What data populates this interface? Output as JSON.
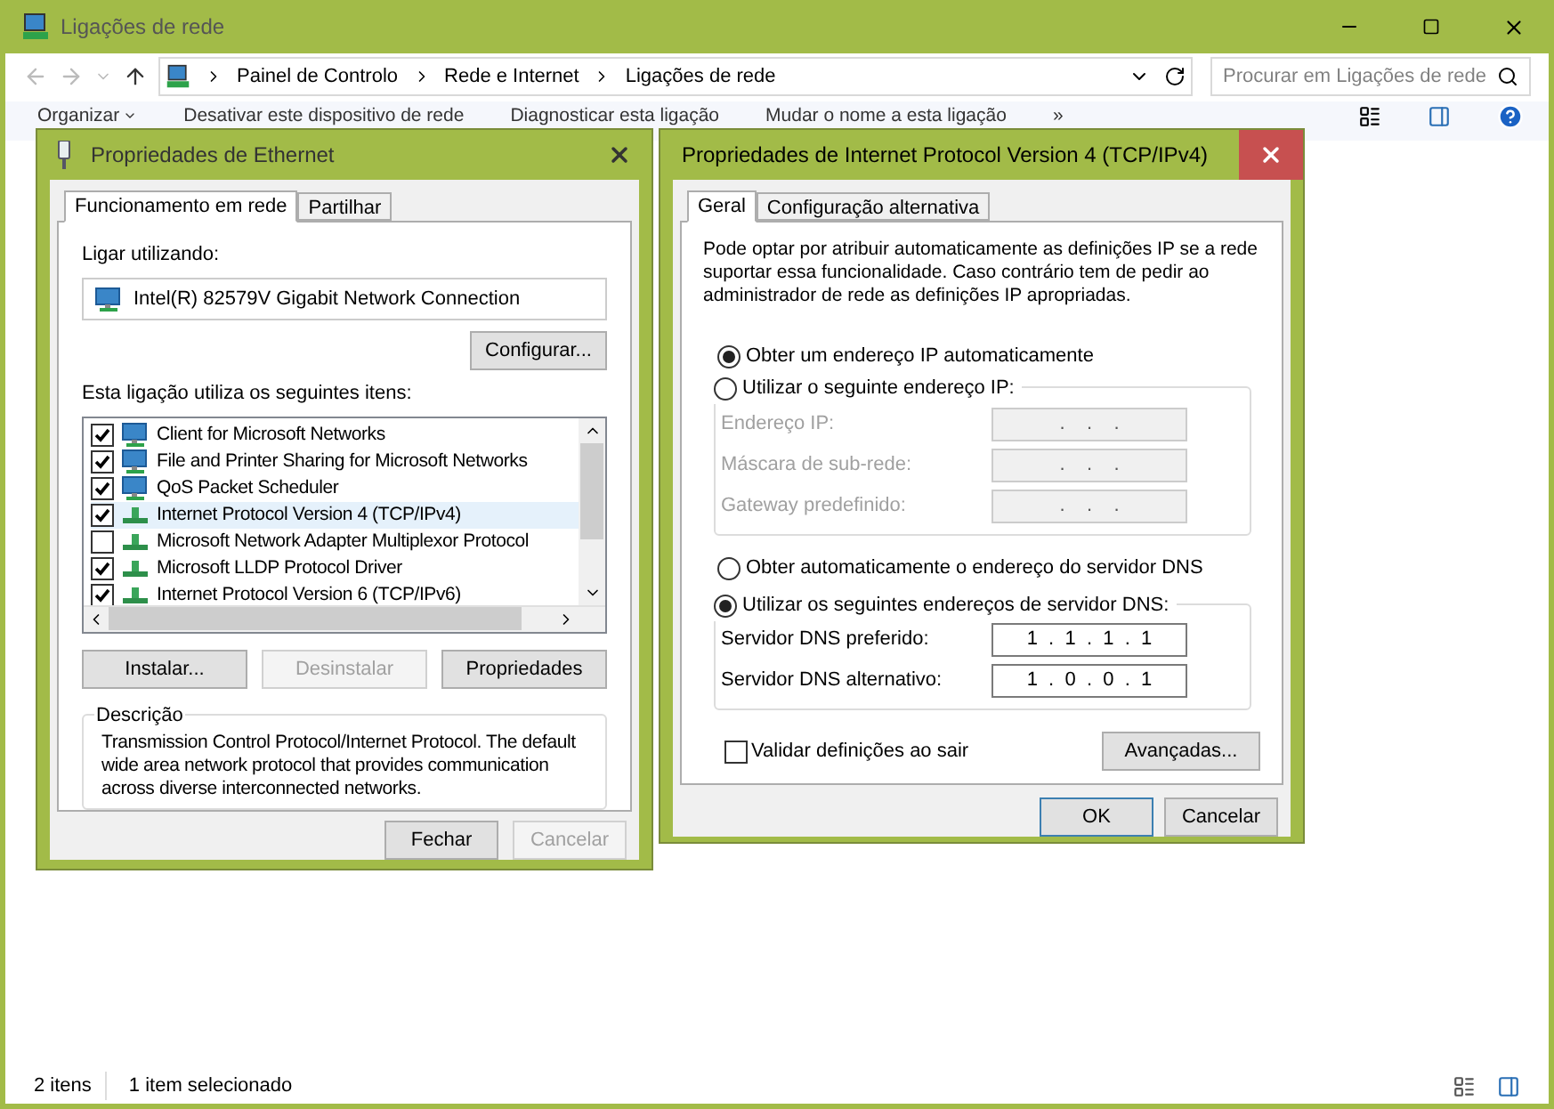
{
  "window": {
    "title": "Ligações de rede"
  },
  "address": {
    "path": [
      "Painel de Controlo",
      "Rede e Internet",
      "Ligações de rede"
    ],
    "search_placeholder": "Procurar em Ligações de rede"
  },
  "toolbar": [
    "Organizar",
    "Desativar este dispositivo de rede",
    "Diagnosticar esta ligação",
    "Mudar o nome a esta ligação",
    "»"
  ],
  "ethernet_dialog": {
    "title": "Propriedades de Ethernet",
    "tabs": [
      {
        "label": "Funcionamento em rede",
        "selected": true
      },
      {
        "label": "Partilhar",
        "selected": false
      }
    ],
    "connect_label": "Ligar utilizando:",
    "adapter": "Intel(R) 82579V Gigabit Network Connection",
    "configure_button": "Configurar...",
    "items_label": "Esta ligação utiliza os seguintes itens:",
    "items": [
      {
        "label": "Client for Microsoft Networks",
        "checked": true,
        "selected": false,
        "kind": "monitor"
      },
      {
        "label": "File and Printer Sharing for Microsoft Networks",
        "checked": true,
        "selected": false,
        "kind": "monitor"
      },
      {
        "label": "QoS Packet Scheduler",
        "checked": true,
        "selected": false,
        "kind": "monitor"
      },
      {
        "label": "Internet Protocol Version 4 (TCP/IPv4)",
        "checked": true,
        "selected": true,
        "kind": "protocol"
      },
      {
        "label": "Microsoft Network Adapter Multiplexor Protocol",
        "checked": false,
        "selected": false,
        "kind": "protocol"
      },
      {
        "label": "Microsoft LLDP Protocol Driver",
        "checked": true,
        "selected": false,
        "kind": "protocol"
      },
      {
        "label": "Internet Protocol Version 6 (TCP/IPv6)",
        "checked": true,
        "selected": false,
        "kind": "protocol"
      }
    ],
    "item_buttons": [
      {
        "label": "Instalar...",
        "disabled": false
      },
      {
        "label": "Desinstalar",
        "disabled": true
      },
      {
        "label": "Propriedades",
        "disabled": false
      }
    ],
    "description_label": "Descrição",
    "description": "Transmission Control Protocol/Internet Protocol. The default wide area network protocol that provides communication across diverse interconnected networks.",
    "footer_buttons": [
      {
        "label": "Fechar",
        "disabled": false
      },
      {
        "label": "Cancelar",
        "disabled": true
      }
    ]
  },
  "ipv4_dialog": {
    "title": "Propriedades de Internet Protocol Version 4 (TCP/IPv4)",
    "tabs": [
      {
        "label": "Geral",
        "selected": true
      },
      {
        "label": "Configuração alternativa",
        "selected": false
      }
    ],
    "intro": "Pode optar por atribuir automaticamente as definições IP se a rede suportar essa funcionalidade. Caso contrário tem de pedir ao administrador de rede as definições IP apropriadas.",
    "ip_options": [
      {
        "label": "Obter um endereço IP automaticamente",
        "selected": true
      },
      {
        "label": "Utilizar o seguinte endereço IP:",
        "selected": false
      }
    ],
    "ip_fields": [
      {
        "label": "Endereço IP:",
        "value": ".    .    .",
        "disabled": true
      },
      {
        "label": "Máscara de sub-rede:",
        "value": ".    .    .",
        "disabled": true
      },
      {
        "label": "Gateway predefinido:",
        "value": ".    .    .",
        "disabled": true
      }
    ],
    "dns_options": [
      {
        "label": "Obter automaticamente o endereço do servidor DNS",
        "selected": false
      },
      {
        "label": "Utilizar os seguintes endereços de servidor DNS:",
        "selected": true
      }
    ],
    "dns_fields": [
      {
        "label": "Servidor DNS preferido:",
        "value": "1  .  1  .  1  .  1",
        "disabled": false
      },
      {
        "label": "Servidor DNS alternativo:",
        "value": "1  .  0  .  0  .  1",
        "disabled": false
      }
    ],
    "validate": {
      "label": "Validar definições ao sair",
      "checked": false
    },
    "advanced_button": "Avançadas...",
    "footer_buttons": [
      {
        "label": "OK",
        "default": true
      },
      {
        "label": "Cancelar",
        "default": false
      }
    ]
  },
  "status_bar": {
    "count": "2 itens",
    "selection": "1 item selecionado"
  }
}
